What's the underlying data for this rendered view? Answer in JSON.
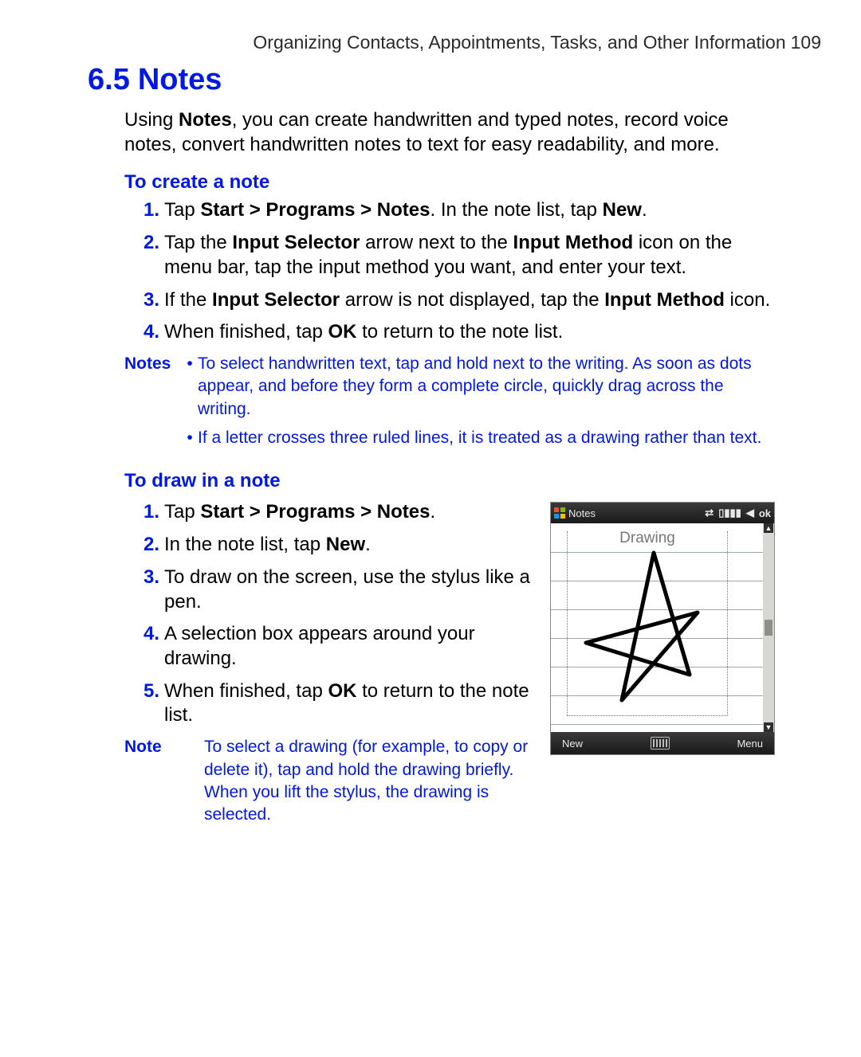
{
  "header": {
    "running_title": "Organizing Contacts, Appointments, Tasks, and Other Information",
    "page_number": "109"
  },
  "section": {
    "number": "6.5",
    "title": "Notes"
  },
  "intro": {
    "pre": "Using ",
    "b1": "Notes",
    "post": ", you can create handwritten and typed notes, record voice notes, convert handwritten notes to text for easy readability, and more."
  },
  "create": {
    "heading": "To create a note",
    "n1": "1.",
    "n2": "2.",
    "n3": "3.",
    "n4": "4.",
    "s1": {
      "a": "Tap ",
      "b": "Start > Programs > Notes",
      "c": ". In the note list, tap ",
      "d": "New",
      "e": "."
    },
    "s2": {
      "a": "Tap the ",
      "b": "Input Selector",
      "c": " arrow next to the ",
      "d": "Input Method",
      "e": " icon on the menu bar, tap the input method you want, and enter your text."
    },
    "s3": {
      "a": "If the ",
      "b": "Input Selector",
      "c": " arrow is not displayed, tap the ",
      "d": "Input Method",
      "e": " icon."
    },
    "s4": {
      "a": "When finished, tap ",
      "b": "OK",
      "c": " to return to the note list."
    }
  },
  "notes_block": {
    "label": "Notes",
    "bullet": "•",
    "i1": "To select handwritten text, tap and hold next to the writing. As soon as dots appear, and before they form a complete circle, quickly drag across the writing.",
    "i2": "If a letter crosses three ruled lines, it is treated as a drawing rather than text."
  },
  "draw": {
    "heading": "To draw in a note",
    "n1": "1.",
    "n2": "2.",
    "n3": "3.",
    "n4": "4.",
    "n5": "5.",
    "s1": {
      "a": "Tap ",
      "b": "Start > Programs > Notes",
      "c": "."
    },
    "s2": {
      "a": "In the note list, tap ",
      "b": "New",
      "c": "."
    },
    "s3": {
      "a": "To draw on the screen, use the stylus like a pen."
    },
    "s4": {
      "a": "A selection box appears around your drawing."
    },
    "s5": {
      "a": "When finished, tap ",
      "b": "OK",
      "c": " to return to the note list."
    }
  },
  "note_single": {
    "label": "Note",
    "text": "To select a drawing (for example, to copy or delete it), tap and hold the drawing briefly. When you lift the stylus, the drawing is selected."
  },
  "phone": {
    "app_title": "Notes",
    "ok": "ok",
    "canvas_label": "Drawing",
    "soft_left": "New",
    "soft_right": "Menu",
    "signal_glyph": "▯▮▮▮",
    "vol_glyph": "◀"
  }
}
